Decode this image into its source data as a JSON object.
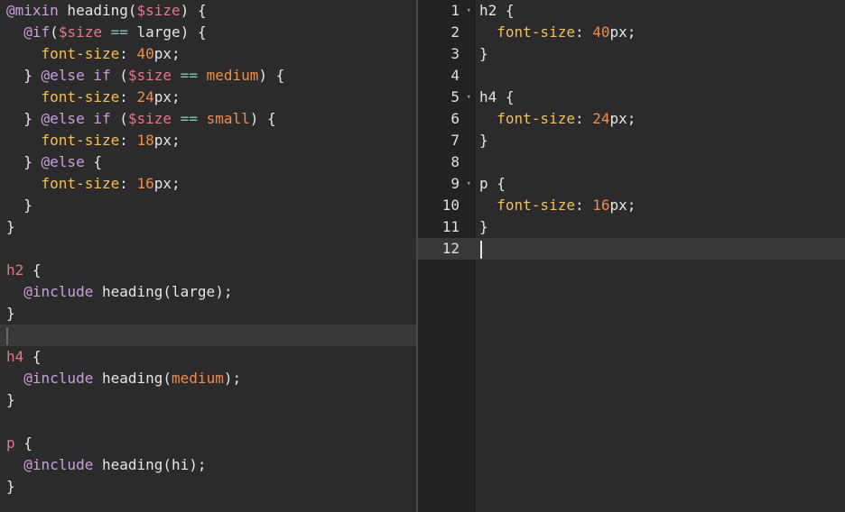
{
  "left_editor": {
    "lines": [
      [
        {
          "c": "t-at",
          "t": "@mixin"
        },
        {
          "c": "t-text",
          "t": " heading("
        },
        {
          "c": "t-var",
          "t": "$size"
        },
        {
          "c": "t-text",
          "t": ") {"
        }
      ],
      [
        {
          "c": "t-text",
          "t": "  "
        },
        {
          "c": "t-at",
          "t": "@if"
        },
        {
          "c": "t-text",
          "t": "("
        },
        {
          "c": "t-var",
          "t": "$size"
        },
        {
          "c": "t-text",
          "t": " "
        },
        {
          "c": "t-op",
          "t": "=="
        },
        {
          "c": "t-text",
          "t": " large) {"
        }
      ],
      [
        {
          "c": "t-text",
          "t": "    "
        },
        {
          "c": "t-prop",
          "t": "font-size"
        },
        {
          "c": "t-text",
          "t": ": "
        },
        {
          "c": "t-num",
          "t": "40"
        },
        {
          "c": "t-text",
          "t": "px;"
        }
      ],
      [
        {
          "c": "t-text",
          "t": "  } "
        },
        {
          "c": "t-at",
          "t": "@else"
        },
        {
          "c": "t-text",
          "t": " "
        },
        {
          "c": "t-kw",
          "t": "if"
        },
        {
          "c": "t-text",
          "t": " ("
        },
        {
          "c": "t-var",
          "t": "$size"
        },
        {
          "c": "t-text",
          "t": " "
        },
        {
          "c": "t-op",
          "t": "=="
        },
        {
          "c": "t-text",
          "t": " "
        },
        {
          "c": "t-arg",
          "t": "medium"
        },
        {
          "c": "t-text",
          "t": ") {"
        }
      ],
      [
        {
          "c": "t-text",
          "t": "    "
        },
        {
          "c": "t-prop",
          "t": "font-size"
        },
        {
          "c": "t-text",
          "t": ": "
        },
        {
          "c": "t-num",
          "t": "24"
        },
        {
          "c": "t-text",
          "t": "px;"
        }
      ],
      [
        {
          "c": "t-text",
          "t": "  } "
        },
        {
          "c": "t-at",
          "t": "@else"
        },
        {
          "c": "t-text",
          "t": " "
        },
        {
          "c": "t-kw",
          "t": "if"
        },
        {
          "c": "t-text",
          "t": " ("
        },
        {
          "c": "t-var",
          "t": "$size"
        },
        {
          "c": "t-text",
          "t": " "
        },
        {
          "c": "t-op",
          "t": "=="
        },
        {
          "c": "t-text",
          "t": " "
        },
        {
          "c": "t-arg",
          "t": "small"
        },
        {
          "c": "t-text",
          "t": ") {"
        }
      ],
      [
        {
          "c": "t-text",
          "t": "    "
        },
        {
          "c": "t-prop",
          "t": "font-size"
        },
        {
          "c": "t-text",
          "t": ": "
        },
        {
          "c": "t-num",
          "t": "18"
        },
        {
          "c": "t-text",
          "t": "px;"
        }
      ],
      [
        {
          "c": "t-text",
          "t": "  } "
        },
        {
          "c": "t-at",
          "t": "@else"
        },
        {
          "c": "t-text",
          "t": " {"
        }
      ],
      [
        {
          "c": "t-text",
          "t": "    "
        },
        {
          "c": "t-prop",
          "t": "font-size"
        },
        {
          "c": "t-text",
          "t": ": "
        },
        {
          "c": "t-num",
          "t": "16"
        },
        {
          "c": "t-text",
          "t": "px;"
        }
      ],
      [
        {
          "c": "t-text",
          "t": "  }"
        }
      ],
      [
        {
          "c": "t-text",
          "t": "}"
        }
      ],
      [],
      [
        {
          "c": "t-sel",
          "t": "h2"
        },
        {
          "c": "t-text",
          "t": " {"
        }
      ],
      [
        {
          "c": "t-text",
          "t": "  "
        },
        {
          "c": "t-at",
          "t": "@include"
        },
        {
          "c": "t-text",
          "t": " heading(large);"
        }
      ],
      [
        {
          "c": "t-text",
          "t": "}"
        }
      ],
      [],
      [
        {
          "c": "t-sel",
          "t": "h4"
        },
        {
          "c": "t-text",
          "t": " {"
        }
      ],
      [
        {
          "c": "t-text",
          "t": "  "
        },
        {
          "c": "t-at",
          "t": "@include"
        },
        {
          "c": "t-text",
          "t": " heading("
        },
        {
          "c": "t-arg",
          "t": "medium"
        },
        {
          "c": "t-text",
          "t": ");"
        }
      ],
      [
        {
          "c": "t-text",
          "t": "}"
        }
      ],
      [],
      [
        {
          "c": "t-sel",
          "t": "p"
        },
        {
          "c": "t-text",
          "t": " {"
        }
      ],
      [
        {
          "c": "t-text",
          "t": "  "
        },
        {
          "c": "t-at",
          "t": "@include"
        },
        {
          "c": "t-text",
          "t": " heading(hi);"
        }
      ],
      [
        {
          "c": "t-text",
          "t": "}"
        }
      ]
    ],
    "active_line_index": 15
  },
  "right_editor": {
    "line_numbers": [
      "1",
      "2",
      "3",
      "4",
      "5",
      "6",
      "7",
      "8",
      "9",
      "10",
      "11",
      "12"
    ],
    "fold_markers": [
      0,
      4,
      8
    ],
    "fold_glyph": "▾",
    "lines": [
      [
        {
          "c": "t-text",
          "t": "h2 {"
        }
      ],
      [
        {
          "c": "t-text",
          "t": "  "
        },
        {
          "c": "t-prop",
          "t": "font-size"
        },
        {
          "c": "t-text",
          "t": ": "
        },
        {
          "c": "t-num",
          "t": "40"
        },
        {
          "c": "t-text",
          "t": "px;"
        }
      ],
      [
        {
          "c": "t-text",
          "t": "}"
        }
      ],
      [],
      [
        {
          "c": "t-text",
          "t": "h4 {"
        }
      ],
      [
        {
          "c": "t-text",
          "t": "  "
        },
        {
          "c": "t-prop",
          "t": "font-size"
        },
        {
          "c": "t-text",
          "t": ": "
        },
        {
          "c": "t-num",
          "t": "24"
        },
        {
          "c": "t-text",
          "t": "px;"
        }
      ],
      [
        {
          "c": "t-text",
          "t": "}"
        }
      ],
      [],
      [
        {
          "c": "t-text",
          "t": "p {"
        }
      ],
      [
        {
          "c": "t-text",
          "t": "  "
        },
        {
          "c": "t-prop",
          "t": "font-size"
        },
        {
          "c": "t-text",
          "t": ": "
        },
        {
          "c": "t-num",
          "t": "16"
        },
        {
          "c": "t-text",
          "t": "px;"
        }
      ],
      [
        {
          "c": "t-text",
          "t": "}"
        }
      ],
      []
    ],
    "active_line_index": 11
  },
  "colors": {
    "background": "#2b2b2b",
    "gutter": "#222222",
    "active_line": "#383838",
    "at_rule": "#c9a0dc",
    "variable": "#e57690",
    "operator": "#7fc8b4",
    "property": "#f2c05c",
    "number": "#f08d49"
  }
}
